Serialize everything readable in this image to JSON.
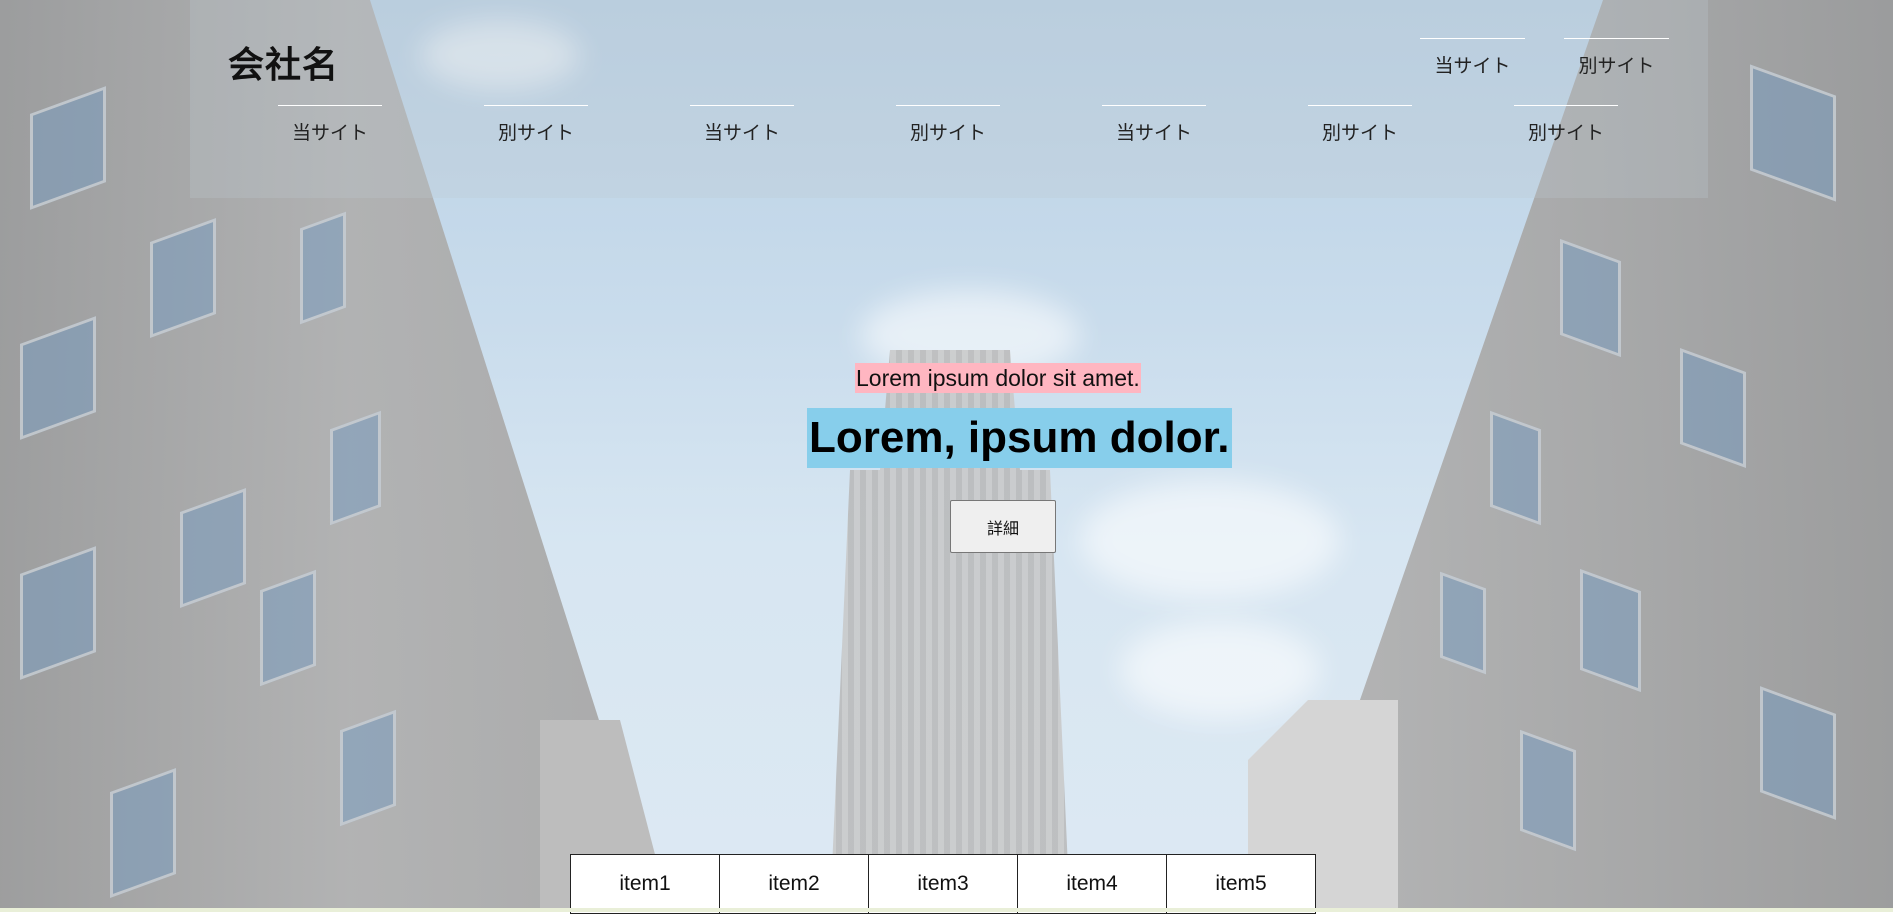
{
  "header": {
    "logo": "会社名",
    "top_nav": [
      "当サイト",
      "別サイト"
    ],
    "main_nav": [
      "当サイト",
      "別サイト",
      "当サイト",
      "別サイト",
      "当サイト",
      "別サイト",
      "別サイト"
    ]
  },
  "hero": {
    "subtitle": "Lorem ipsum dolor sit amet.",
    "title": "Lorem, ipsum dolor.",
    "button_label": "詳細",
    "subtitle_bg": "#ffb6c1",
    "title_bg": "#87ceeb"
  },
  "tabs": [
    "item1",
    "item2",
    "item3",
    "item4",
    "item5"
  ]
}
